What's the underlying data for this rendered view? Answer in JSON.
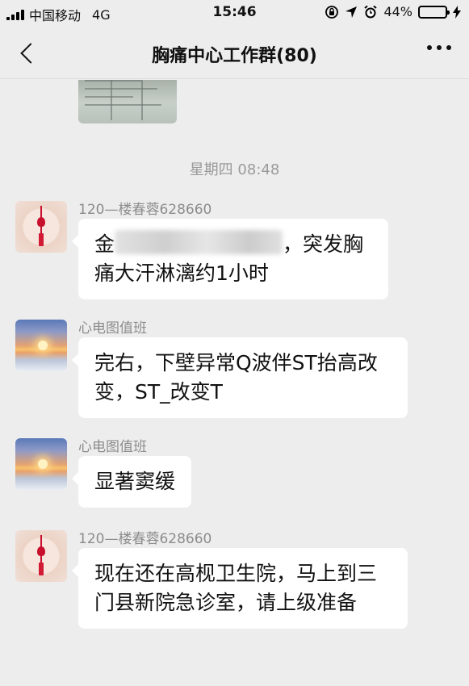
{
  "status_bar": {
    "carrier": "中国移动",
    "network": "4G",
    "time": "15:46",
    "battery": "44%",
    "battery_level": 0.44
  },
  "nav": {
    "back_icon": "chevron-left-icon",
    "title": "胸痛中心工作群(80)",
    "more_icon": "more-dots-icon"
  },
  "chat": {
    "timestamp": "星期四 08:48",
    "messages": [
      {
        "sender": "120—楼春蓉628660",
        "avatar": "red-chinese-knot-avatar",
        "text_prefix": "金",
        "text_suffix": "，突发胸痛大汗淋漓约1小时"
      },
      {
        "sender": "心电图值班",
        "avatar": "sunset-avatar",
        "text": "完右，下壁异常Q波伴ST抬高改变，ST_改变T"
      },
      {
        "sender": "心电图值班",
        "avatar": "sunset-avatar",
        "text": "显著窦缓"
      },
      {
        "sender": "120—楼春蓉628660",
        "avatar": "red-chinese-knot-avatar",
        "text": "现在还在高枧卫生院，马上到三门县新院急诊室，请上级准备"
      }
    ]
  },
  "colors": {
    "background": "#ededed",
    "bubble": "#ffffff",
    "battery_fill": "#4cd964",
    "meta_text": "#9a9a9a"
  }
}
